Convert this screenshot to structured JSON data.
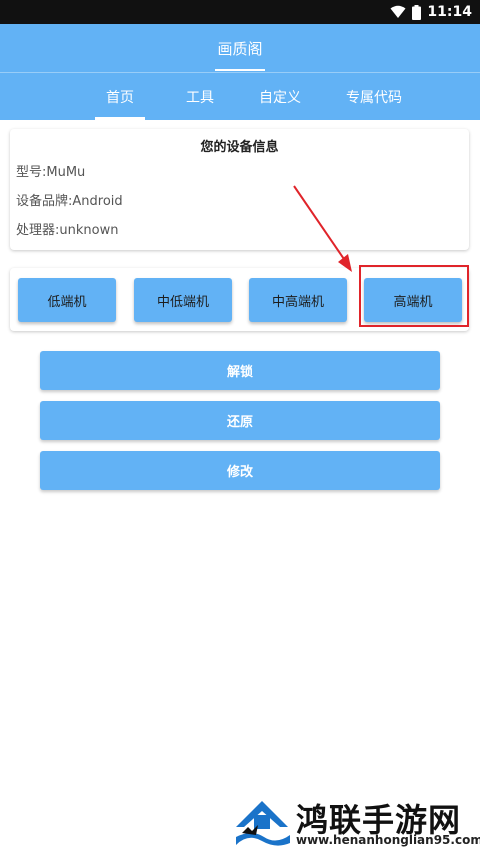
{
  "status_bar": {
    "time": "11:14"
  },
  "header": {
    "title": "画质阁",
    "tabs": [
      {
        "label": "首页",
        "active": true
      },
      {
        "label": "工具",
        "active": false
      },
      {
        "label": "自定义",
        "active": false
      },
      {
        "label": "专属代码",
        "active": false
      }
    ]
  },
  "device_info": {
    "title": "您的设备信息",
    "model": "型号:MuMu",
    "brand": "设备品牌:Android",
    "processor": "处理器:unknown"
  },
  "presets": [
    {
      "label": "低端机"
    },
    {
      "label": "中低端机"
    },
    {
      "label": "中高端机"
    },
    {
      "label": "高端机",
      "highlighted": true
    }
  ],
  "actions": {
    "unlock": "解锁",
    "restore": "还原",
    "modify": "修改"
  },
  "watermark": {
    "name": "鸿联手游网",
    "url": "www.henanhonglian95.com"
  },
  "colors": {
    "primary": "#62b2f5",
    "highlight": "#e0242a",
    "status_bar": "#111111"
  }
}
